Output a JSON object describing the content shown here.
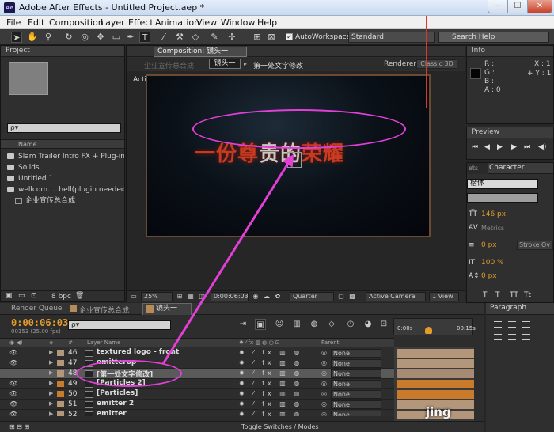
{
  "window": {
    "app_icon": "Ae",
    "title": "Adobe After Effects - Untitled Project.aep *",
    "controls": [
      "—",
      "☐",
      "✕"
    ]
  },
  "menu": [
    "File",
    "Edit",
    "Composition",
    "Layer",
    "Effect",
    "Animation",
    "View",
    "Window",
    "Help"
  ],
  "toolbar": {
    "autoworkspace_label": "AutoWorkspace:",
    "workspace_value": "Standard",
    "search_help_placeholder": "Search Help"
  },
  "project": {
    "tab": "Project",
    "search_value": "ρ▾",
    "list_header": "Name",
    "items": [
      {
        "name": "Slam Trailer Intro FX + Plug-in",
        "type": "folder"
      },
      {
        "name": "Solids",
        "type": "folder"
      },
      {
        "name": "Untitled 1",
        "type": "folder"
      },
      {
        "name": "wellcom.....hell(plugin needed)",
        "type": "folder"
      },
      {
        "name": "企业宣传总合成",
        "type": "comp"
      }
    ],
    "bpc": "8 bpc"
  },
  "composition": {
    "tab_label": "Composition: 镜头一",
    "flow_parent": "企业宣传总合成",
    "flow_current": "镜头一",
    "flow_child": "第一处文字修改",
    "renderer_label": "Renderer:",
    "renderer_value": "Classic 3D",
    "view_label": "Active Camera",
    "title_text_red": "一份尊",
    "title_text_light": "贵的",
    "title_text_red2": "荣耀",
    "zoom": "25%",
    "timecode": "0:00:06:03",
    "quality": "Quarter",
    "camera_select": "Active Camera",
    "view_count": "1 View"
  },
  "info": {
    "tab": "Info",
    "letters": [
      "R :",
      "G :",
      "B :",
      "A : 0"
    ],
    "x": "X : 1",
    "y": "+ Y : 1"
  },
  "preview": {
    "tab": "Preview"
  },
  "character": {
    "tab_prev": "ets",
    "tab": "Character",
    "font": "楷体",
    "size": "146 px",
    "metrics": "Metrics",
    "stroke_width": "0 px",
    "stroke_mode": "Stroke Ov",
    "vscale": "100 %",
    "baseline": "0 px"
  },
  "timeline": {
    "tabs": [
      "Render Queue",
      "企业宣传总合成",
      "镜头一"
    ],
    "timecode": "0:00:06:03",
    "frames": "00153 (25.00 fps)",
    "search_value": "ρ▾",
    "ruler_start": "0:00s",
    "ruler_end": "00:15s",
    "headers": {
      "label": "#",
      "name": "Layer Name",
      "parent": "Parent"
    },
    "layers": [
      {
        "num": "46",
        "name": "textured logo - front",
        "label_color": "#b4967a",
        "has_eye": true,
        "parent": "None"
      },
      {
        "num": "47",
        "name": "emitterop",
        "label_color": "#b4967a",
        "has_eye": true,
        "parent": "None"
      },
      {
        "num": "48",
        "name": "[第一处文字修改]",
        "label_color": "#b4967a",
        "has_eye": false,
        "parent": "None",
        "selected": true
      },
      {
        "num": "49",
        "name": "[Particles 2]",
        "label_color": "#c97a2a",
        "has_eye": true,
        "parent": "None"
      },
      {
        "num": "50",
        "name": "[Particles]",
        "label_color": "#c97a2a",
        "has_eye": true,
        "parent": "None"
      },
      {
        "num": "51",
        "name": "emitter 2",
        "label_color": "#b4967a",
        "has_eye": true,
        "parent": "None"
      },
      {
        "num": "52",
        "name": "emitter",
        "label_color": "#b4967a",
        "has_eye": true,
        "parent": "None"
      }
    ],
    "toggle_label": "Toggle Switches / Modes"
  },
  "paragraph": {
    "tab": "Paragraph"
  },
  "annotation_color": "#e23fd7",
  "watermark": "jing"
}
